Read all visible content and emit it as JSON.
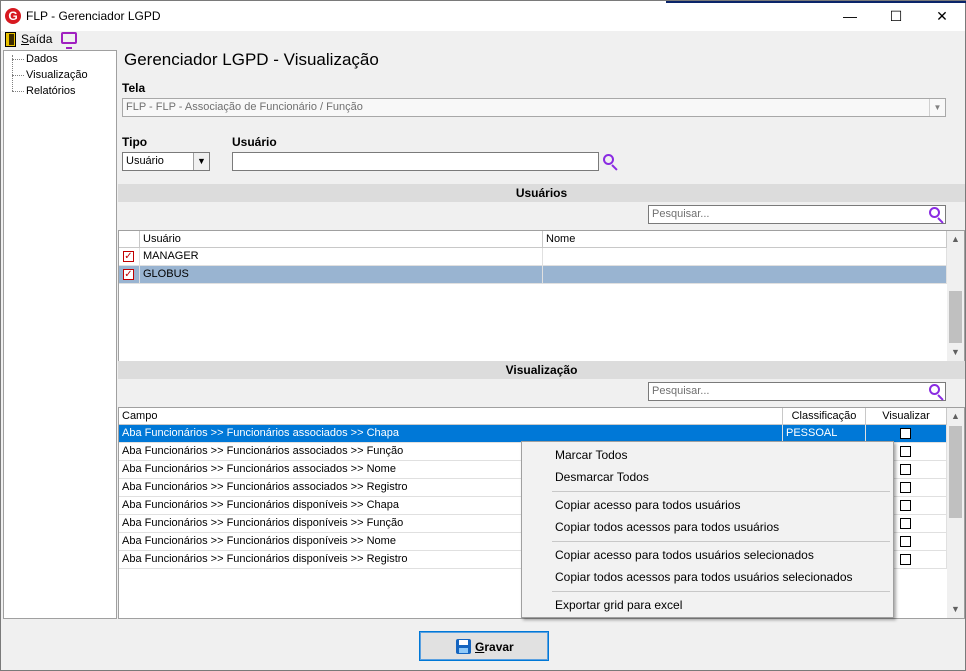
{
  "window": {
    "title": "FLP - Gerenciador LGPD",
    "logo_letter": "G",
    "minimize": "—",
    "maximize": "☐",
    "close": "✕"
  },
  "menu": {
    "saida_first": "S",
    "saida_rest": "aída"
  },
  "tree": {
    "items": [
      "Dados",
      "Visualização",
      "Relatórios"
    ]
  },
  "header": {
    "title": "Gerenciador LGPD - Visualização"
  },
  "form": {
    "tela_label": "Tela",
    "tela_value": "FLP - FLP - Associação de Funcionário / Função",
    "tipo_label": "Tipo",
    "tipo_value": "Usuário",
    "usuario_label": "Usuário",
    "usuario_value": ""
  },
  "usuarios_section": {
    "title": "Usuários",
    "search_placeholder": "Pesquisar...",
    "columns": [
      "Usuário",
      "Nome"
    ],
    "rows": [
      {
        "checked": true,
        "usuario": "MANAGER",
        "nome": ""
      },
      {
        "checked": true,
        "usuario": "GLOBUS",
        "nome": ""
      }
    ]
  },
  "visualizacao_section": {
    "title": "Visualização",
    "search_placeholder": "Pesquisar...",
    "columns": [
      "Campo",
      "Classificação",
      "Visualizar"
    ],
    "rows": [
      {
        "campo": "Aba Funcionários >> Funcionários associados >> Chapa",
        "classificacao": "PESSOAL",
        "visualizar": false
      },
      {
        "campo": "Aba Funcionários >> Funcionários associados >> Função",
        "classificacao": "",
        "visualizar": false
      },
      {
        "campo": "Aba Funcionários >> Funcionários associados >> Nome",
        "classificacao": "",
        "visualizar": false
      },
      {
        "campo": "Aba Funcionários >> Funcionários associados >> Registro",
        "classificacao": "",
        "visualizar": false
      },
      {
        "campo": "Aba Funcionários >> Funcionários disponíveis >> Chapa",
        "classificacao": "",
        "visualizar": false
      },
      {
        "campo": "Aba Funcionários >> Funcionários disponíveis >> Função",
        "classificacao": "",
        "visualizar": false
      },
      {
        "campo": "Aba Funcionários >> Funcionários disponíveis >> Nome",
        "classificacao": "",
        "visualizar": false
      },
      {
        "campo": "Aba Funcionários >> Funcionários disponíveis >> Registro",
        "classificacao": "",
        "visualizar": false
      }
    ]
  },
  "context_menu": {
    "marcar_todos": "Marcar Todos",
    "desmarcar_todos": "Desmarcar Todos",
    "copiar_acesso_todos": "Copiar acesso para todos usuários",
    "copiar_todos_acessos_todos": "Copiar todos acessos para todos usuários",
    "copiar_acesso_selecionados": "Copiar acesso para todos usuários selecionados",
    "copiar_todos_acessos_selecionados": "Copiar todos acessos para todos usuários selecionados",
    "exportar_excel": "Exportar grid para excel"
  },
  "footer": {
    "gravar_first": "G",
    "gravar_rest": "ravar"
  },
  "colors": {
    "selection": "#0078d7",
    "row_highlight": "#99b4d1",
    "search_icon": "#8a2be2",
    "logo": "#d71920"
  }
}
